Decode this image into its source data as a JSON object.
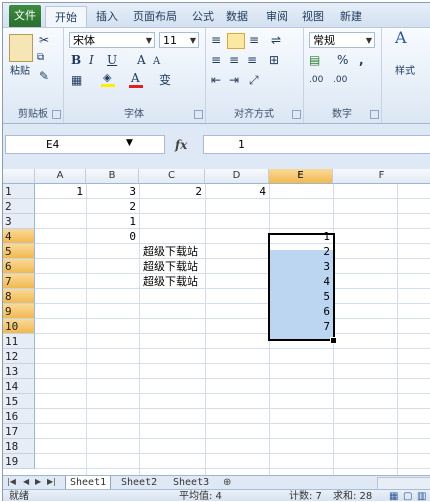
{
  "ribbon_tabs": [
    "文件",
    "开始",
    "插入",
    "页面布局",
    "公式",
    "数据",
    "审阅",
    "视图",
    "新建"
  ],
  "active_tab": "开始",
  "clipboard": {
    "paste_label": "粘贴",
    "group_label": "剪贴板"
  },
  "font": {
    "name": "宋体",
    "size": "11",
    "group_label": "字体",
    "bold": "B",
    "italic": "I",
    "underline": "U",
    "grow": "A",
    "shrink": "A",
    "wen": "变"
  },
  "alignment": {
    "group_label": "对齐方式"
  },
  "number": {
    "format": "常规",
    "group_label": "数字",
    "percent": "%",
    "comma": ",",
    "dec_inc": ".00",
    "dec_dec": ".00"
  },
  "styles": {
    "label": "样式"
  },
  "formula_bar": {
    "name_box": "E4",
    "fx": "fx",
    "value": "1"
  },
  "columns": [
    "A",
    "B",
    "C",
    "D",
    "E",
    "F"
  ],
  "selected_column": "E",
  "rows": [
    "1",
    "2",
    "3",
    "4",
    "5",
    "6",
    "7",
    "8",
    "9",
    "10",
    "11",
    "12",
    "13",
    "14",
    "15",
    "16",
    "17",
    "18",
    "19"
  ],
  "cells": {
    "A1": "1",
    "B1": "3",
    "C1": "2",
    "D1": "4",
    "B2": "2",
    "B3": "1",
    "B4": "0",
    "C5": "超级下载站",
    "C6": "超级下载站",
    "C7": "超级下载站",
    "E4": "1",
    "E5": "2",
    "E6": "3",
    "E7": "4",
    "E8": "5",
    "E9": "6",
    "E10": "7"
  },
  "sheets": [
    "Sheet1",
    "Sheet2",
    "Sheet3"
  ],
  "active_sheet": "Sheet1",
  "status": {
    "mode": "就绪",
    "average": "平均值: 4",
    "count": "计数: 7",
    "sum": "求和: 28"
  }
}
